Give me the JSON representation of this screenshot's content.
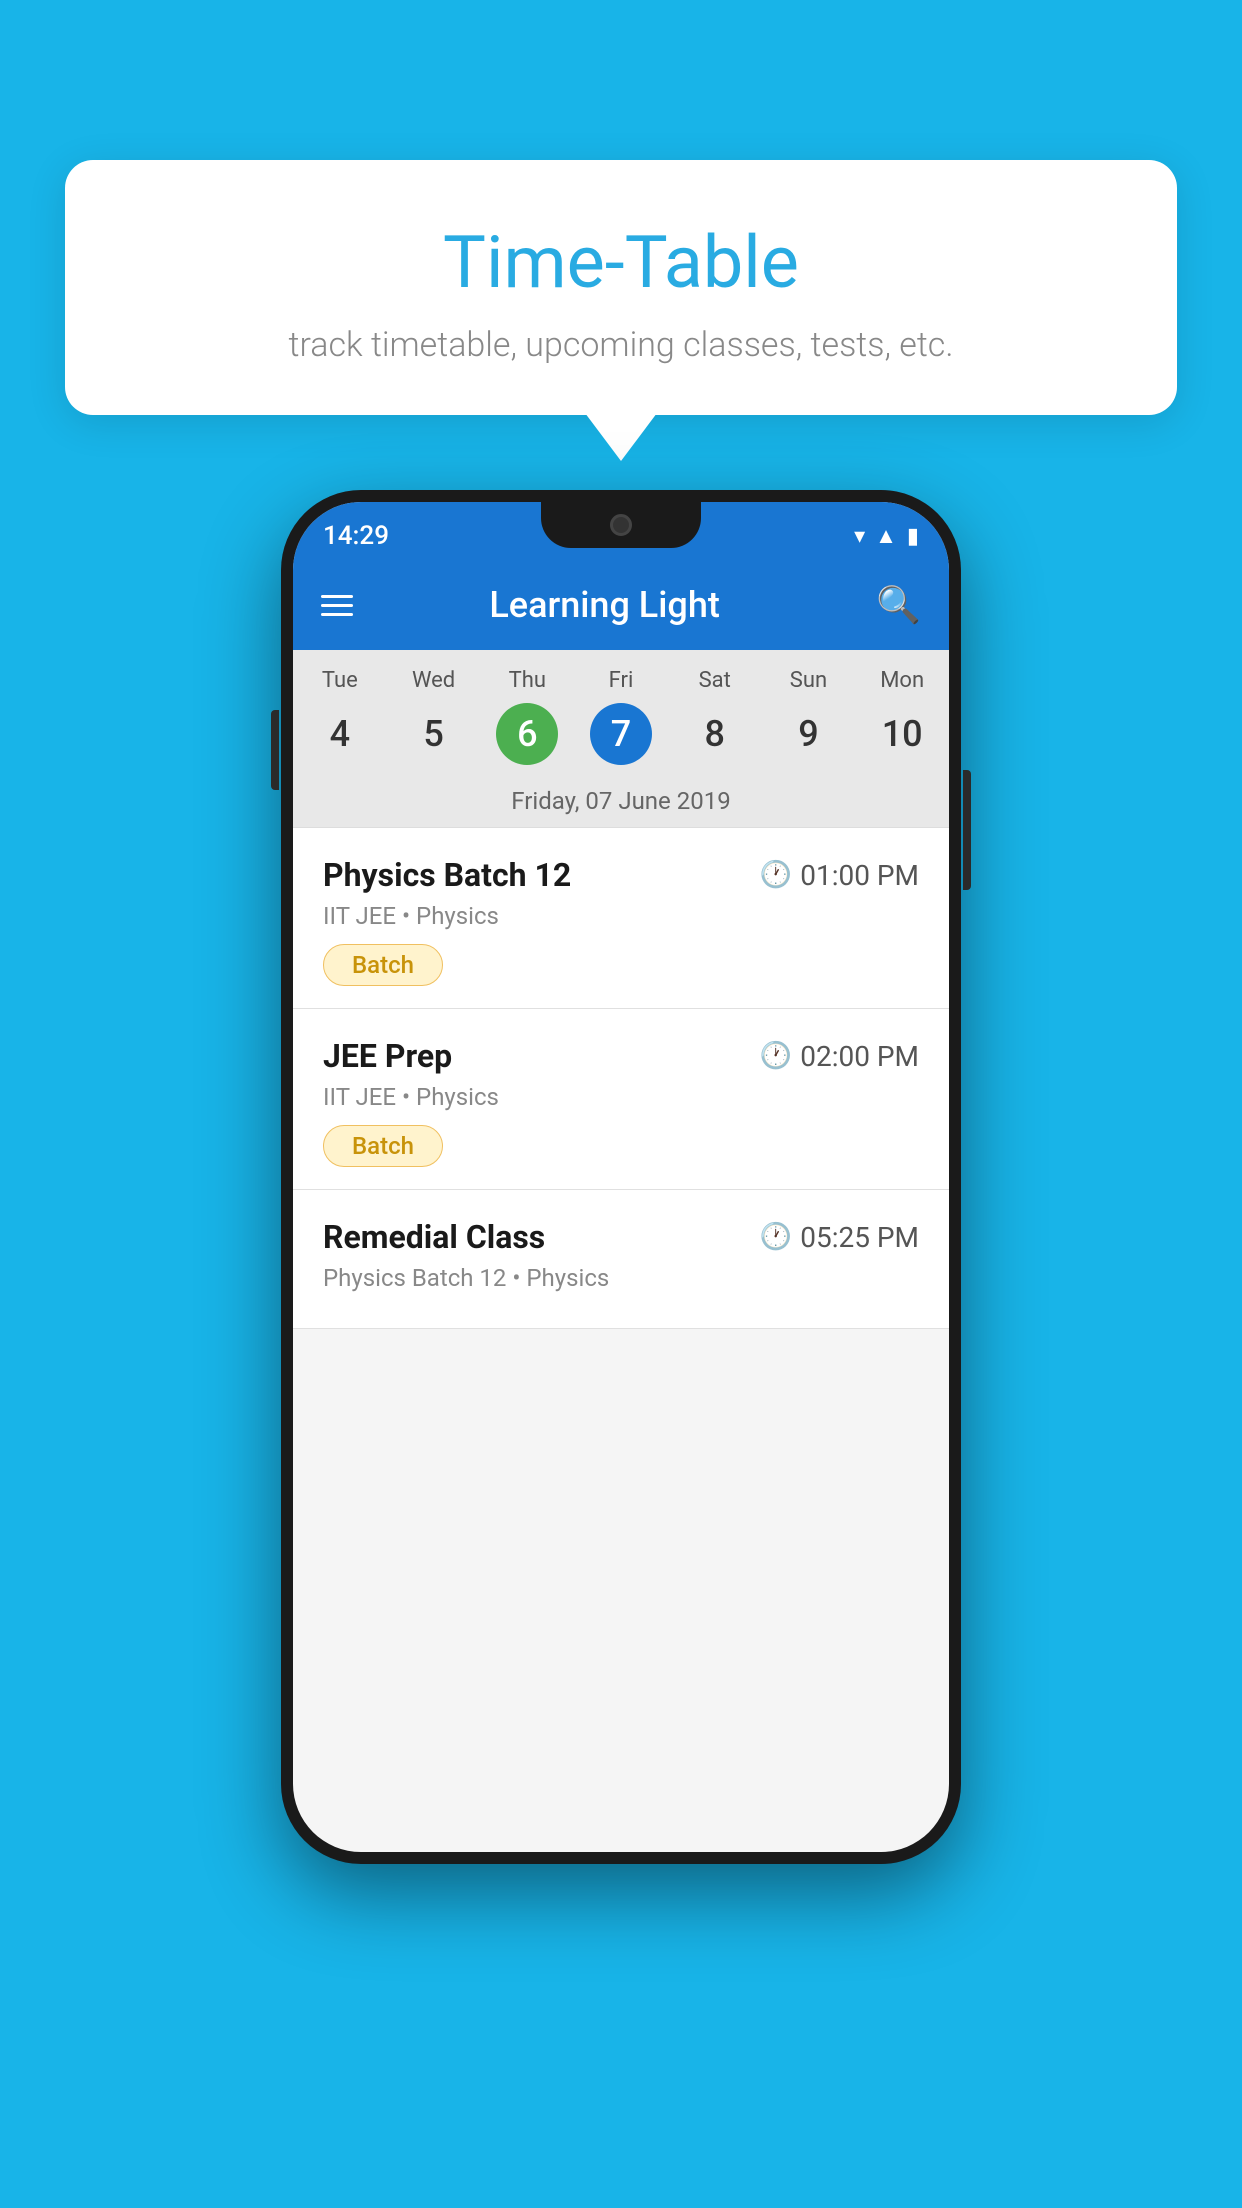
{
  "background_color": "#18b4e8",
  "tooltip": {
    "title": "Time-Table",
    "subtitle": "track timetable, upcoming classes, tests, etc."
  },
  "phone": {
    "status_bar": {
      "time": "14:29"
    },
    "app_bar": {
      "title": "Learning Light"
    },
    "calendar": {
      "days": [
        {
          "name": "Tue",
          "number": "4",
          "state": "normal"
        },
        {
          "name": "Wed",
          "number": "5",
          "state": "normal"
        },
        {
          "name": "Thu",
          "number": "6",
          "state": "today"
        },
        {
          "name": "Fri",
          "number": "7",
          "state": "selected"
        },
        {
          "name": "Sat",
          "number": "8",
          "state": "normal"
        },
        {
          "name": "Sun",
          "number": "9",
          "state": "normal"
        },
        {
          "name": "Mon",
          "number": "10",
          "state": "normal"
        }
      ],
      "selected_date_label": "Friday, 07 June 2019"
    },
    "classes": [
      {
        "name": "Physics Batch 12",
        "time": "01:00 PM",
        "meta": "IIT JEE • Physics",
        "badge": "Batch"
      },
      {
        "name": "JEE Prep",
        "time": "02:00 PM",
        "meta": "IIT JEE • Physics",
        "badge": "Batch"
      },
      {
        "name": "Remedial Class",
        "time": "05:25 PM",
        "meta": "Physics Batch 12 • Physics",
        "badge": null
      }
    ]
  }
}
